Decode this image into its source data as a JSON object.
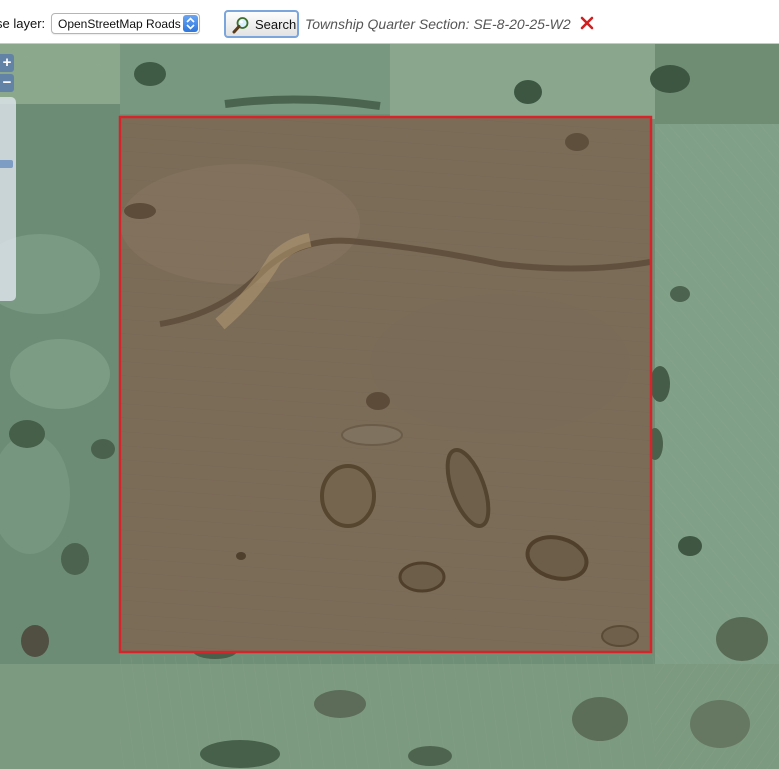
{
  "toolbar": {
    "base_layer_label": "se layer:",
    "base_layer_value": "OpenStreetMap Roads",
    "search_label": "Search",
    "result_text": "Township Quarter Section: SE-8-20-25-W2"
  },
  "map": {
    "view": "satellite imagery",
    "selection_outline_color": "#d6242a",
    "zoom_in_label": "+",
    "zoom_out_label": "−"
  },
  "colors": {
    "toolbar_bg": "#ffffff",
    "clear_icon": "#d11f1f",
    "field_green": "#6f8f74",
    "parcel_brown": "#7b6b57"
  }
}
